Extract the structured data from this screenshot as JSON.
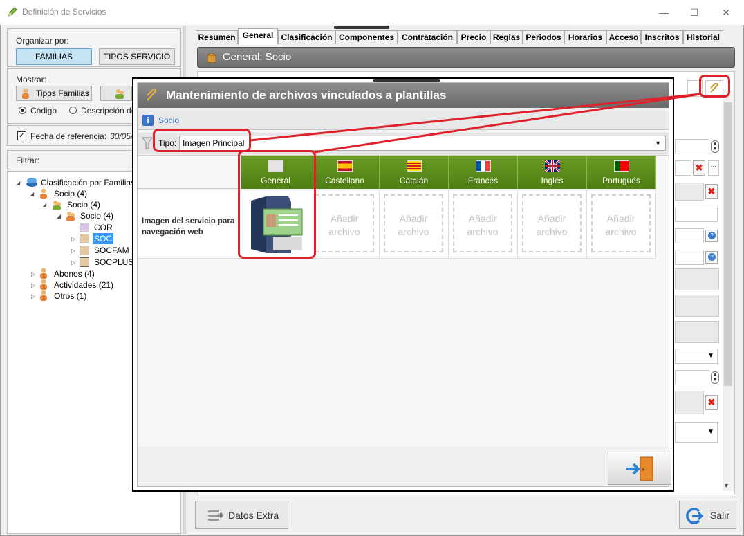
{
  "window": {
    "title": "Definición de Servicios"
  },
  "left": {
    "organizar_label": "Organizar por:",
    "familias_button": "FAMILIAS",
    "tipos_servicio_button": "TIPOS SERVICIO",
    "mostrar_label": "Mostrar:",
    "tipos_familias_button": "Tipos Familias",
    "radio_codigo": "Código",
    "radio_descripcion": "Descripción de",
    "fecha_label": "Fecha de referencia:",
    "fecha_value": "30/05/",
    "filtrar_label": "Filtrar:",
    "tree": [
      {
        "label": "Clasificación por Familias"
      },
      {
        "label": "Socio (4)"
      },
      {
        "label": "Socio (4)"
      },
      {
        "label": "Socio (4)"
      },
      {
        "label": "COR"
      },
      {
        "label": "SOC"
      },
      {
        "label": "SOCFAM"
      },
      {
        "label": "SOCPLUS"
      },
      {
        "label": "Abonos (4)"
      },
      {
        "label": "Actividades (21)"
      },
      {
        "label": "Otros (1)"
      }
    ]
  },
  "tabs": [
    "Resumen",
    "General",
    "Clasificación",
    "Componentes",
    "Contratación",
    "Precio",
    "Reglas",
    "Periodos",
    "Horarios",
    "Acceso",
    "Inscritos",
    "Historial"
  ],
  "section_title": "General: Socio",
  "bottom": {
    "datos_extra": "Datos Extra",
    "salir": "Salir"
  },
  "modal": {
    "title": "Mantenimiento de archivos vinculados a plantillas",
    "entity": "Socio",
    "tipo_label": "Tipo:",
    "tipo_value": "Imagen Principal",
    "columns": [
      "General",
      "Castellano",
      "Catalán",
      "Francés",
      "Inglés",
      "Portugués"
    ],
    "row_label": "Imagen del servicio para navegación web",
    "add_file_label_line1": "Añadir",
    "add_file_label_line2": "archivo"
  },
  "colors": {
    "accent_red": "#e0202a",
    "header_green": "#5a8a1a",
    "selection_blue": "#c4e3f3"
  },
  "icons": [
    "edit-pencil-icon",
    "info-icon",
    "filter-icon",
    "exit-door-icon",
    "salir-icon",
    "datos-extra-icon",
    "attach-icon"
  ]
}
